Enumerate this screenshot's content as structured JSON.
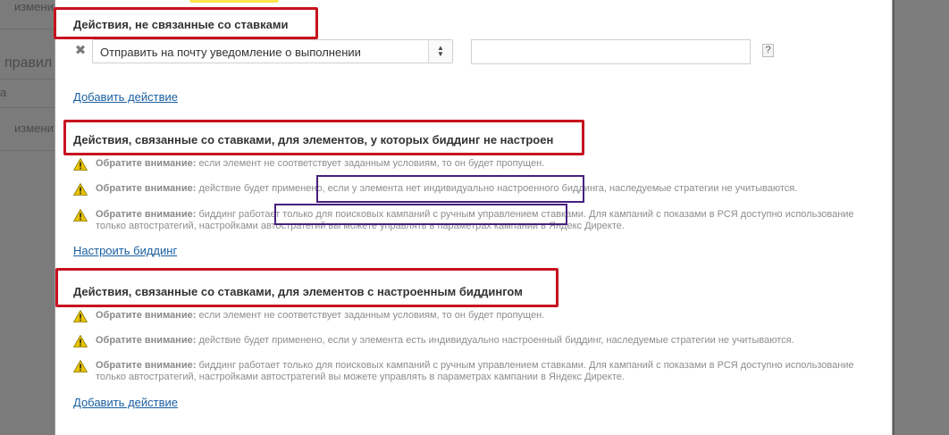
{
  "background": {
    "left_fragments": [
      "изменит",
      "правил",
      "а",
      "изменит"
    ]
  },
  "sections": {
    "non_bid": {
      "title": "Действия, не связанные со ставками",
      "action": {
        "selected": "Отправить на почту уведомление о выполнении",
        "value": "",
        "help": "?"
      },
      "add_link": "Добавить действие"
    },
    "bid_not_configured": {
      "title": "Действия, связанные со ставками, для элементов, у которых биддинг не настроен",
      "notes": [
        {
          "label": "Обратите внимание:",
          "text": "если элемент не соответствует заданным условиям, то он будет пропущен."
        },
        {
          "label": "Обратите внимание:",
          "text": "действие будет применено, если у элемента нет индивидуально настроенного биддинга, наследуемые стратегии не учитываются."
        },
        {
          "label": "Обратите внимание:",
          "text": "биддинг работает только для поисковых кампаний с ручным управлением ставками. Для кампаний с показами в РСЯ доступно использование только автостратегий, настройками автостратегий вы можете управлять в параметрах кампании в Яндекс Директе."
        }
      ],
      "link": "Настроить биддинг"
    },
    "bid_configured": {
      "title": "Действия, связанные со ставками, для элементов с настроенным биддингом",
      "notes": [
        {
          "label": "Обратите внимание:",
          "text": "если элемент не соответствует заданным условиям, то он будет пропущен."
        },
        {
          "label": "Обратите внимание:",
          "text": "действие будет применено, если у элемента есть индивидуально настроенный биддинг, наследуемые стратегии не учитываются."
        },
        {
          "label": "Обратите внимание:",
          "text": "биддинг работает только для поисковых кампаний с ручным управлением ставками. Для кампаний с показами в РСЯ доступно использование только автостратегий, настройками автостратегий вы можете управлять в параметрах кампании в Яндекс Директе."
        }
      ],
      "add_link": "Добавить действие"
    }
  },
  "colors": {
    "highlight_red": "#c7121f",
    "highlight_purple": "#46207e",
    "link": "#1a5fa0",
    "warning_icon": "#e8c200"
  },
  "icons": {
    "remove": "close-icon",
    "warning": "warning-triangle-icon",
    "select_arrows": "chevron-updown-icon"
  }
}
